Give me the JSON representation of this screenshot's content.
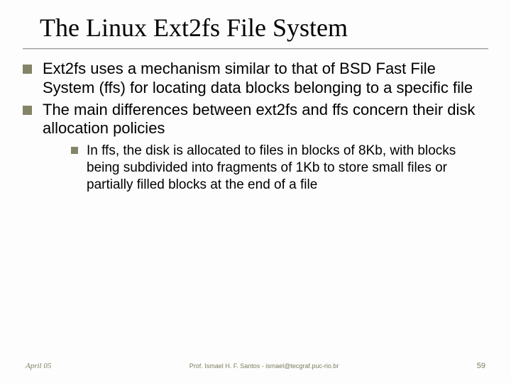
{
  "title": "The Linux Ext2fs File System",
  "bullets": {
    "b1": "Ext2fs uses a mechanism similar to that of BSD Fast File System (ffs) for locating data blocks belonging to a specific file",
    "b2": "The main differences between ext2fs and ffs concern their disk allocation policies",
    "b2_1": "In ffs, the disk is allocated to files in blocks of 8Kb, with blocks being subdivided into fragments of 1Kb to store small files or partially filled blocks at the end of a file"
  },
  "footer": {
    "date": "April 05",
    "prof": "Prof. Ismael H. F. Santos - ismael@tecgraf.puc-rio.br",
    "num": "59"
  },
  "chart_data": {
    "type": "table",
    "note": "Presentation slide; no quantitative chart. Content is hierarchical bullet text.",
    "outline": [
      {
        "level": 1,
        "text": "Ext2fs uses a mechanism similar to that of BSD Fast File System (ffs) for locating data blocks belonging to a specific file"
      },
      {
        "level": 1,
        "text": "The main differences between ext2fs and ffs concern their disk allocation policies"
      },
      {
        "level": 2,
        "text": "In ffs, the disk is allocated to files in blocks of 8Kb, with blocks being subdivided into fragments of 1Kb to store small files or partially filled blocks at the end of a file"
      }
    ]
  }
}
